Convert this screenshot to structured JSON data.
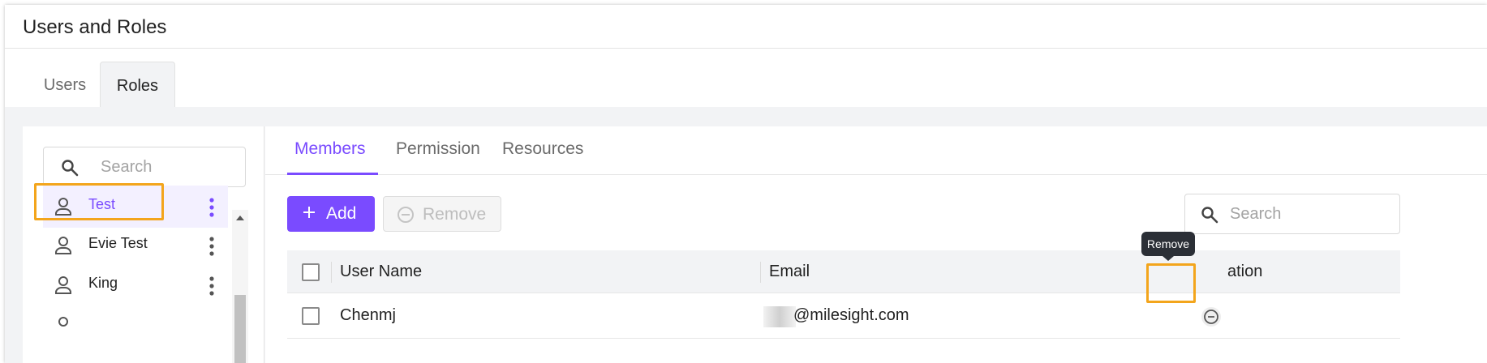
{
  "header": {
    "title": "Users and Roles"
  },
  "top_tabs": [
    {
      "label": "Users",
      "active": false
    },
    {
      "label": "Roles",
      "active": true
    }
  ],
  "roles_panel": {
    "search_placeholder": "Search",
    "roles": [
      {
        "name": "Test",
        "active": true,
        "highlighted": true
      },
      {
        "name": "Evie Test",
        "active": false
      },
      {
        "name": "King",
        "active": false
      }
    ]
  },
  "sub_tabs": [
    {
      "label": "Members",
      "active": true
    },
    {
      "label": "Permission",
      "active": false
    },
    {
      "label": "Resources",
      "active": false
    }
  ],
  "toolbar": {
    "add_label": "Add",
    "remove_label": "Remove",
    "search_placeholder": "Search"
  },
  "table": {
    "columns": [
      "User Name",
      "Email",
      "ation"
    ],
    "rows": [
      {
        "user_name": "Chenmj",
        "email": "@milesight.com"
      }
    ]
  },
  "tooltip": {
    "text": "Remove"
  },
  "colors": {
    "accent": "#7a4bff",
    "highlight": "#f3a51c",
    "tooltip_bg": "#2b2f36"
  },
  "icons": {
    "search": "search-icon",
    "person": "person-icon",
    "kebab": "kebab-menu-icon",
    "add": "plus-icon",
    "remove": "minus-circle-icon"
  }
}
